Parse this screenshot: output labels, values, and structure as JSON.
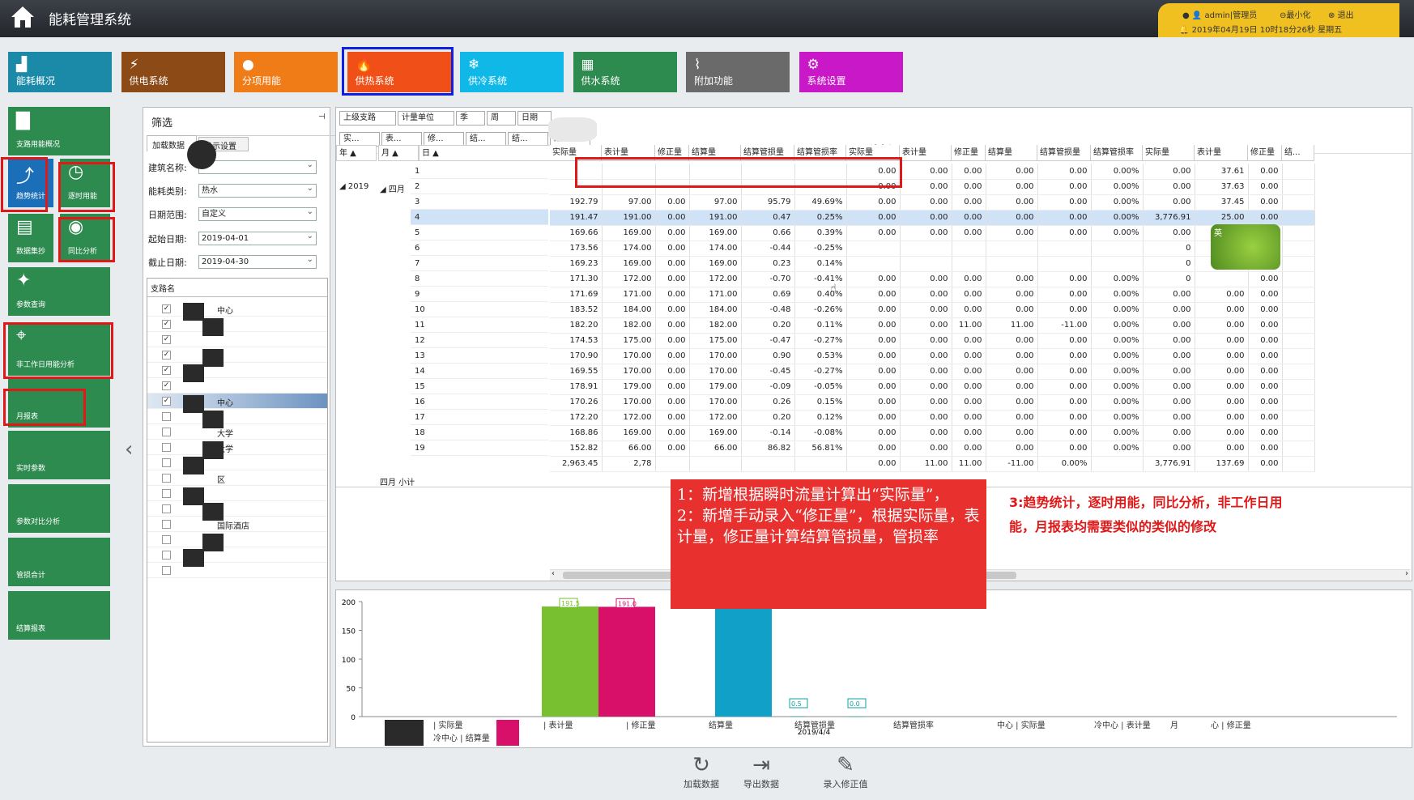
{
  "app": {
    "title": "能耗管理系统"
  },
  "user": {
    "account": "admin|管理员",
    "minimize": "最小化",
    "logout": "退出",
    "datetime": "2019年04月19日 10时18分26秒 星期五"
  },
  "nav": [
    {
      "label": "能耗概况",
      "icon": "stats-icon",
      "color": "#1a8aa8"
    },
    {
      "label": "供电系统",
      "icon": "power-icon",
      "color": "#8b4a16"
    },
    {
      "label": "分项用能",
      "icon": "user-icon",
      "color": "#f07c18"
    },
    {
      "label": "供热系统",
      "icon": "flame-icon",
      "color": "#f05018"
    },
    {
      "label": "供冷系统",
      "icon": "snowflake-icon",
      "color": "#10b8e8"
    },
    {
      "label": "供水系统",
      "icon": "grid-icon",
      "color": "#2e8b50"
    },
    {
      "label": "附加功能",
      "icon": "pulse-icon",
      "color": "#6a6a6a"
    },
    {
      "label": "系统设置",
      "icon": "gear-icon",
      "color": "#c818c8"
    }
  ],
  "side": [
    "支路用能概况",
    "趋势统计",
    "逐时用能",
    "数据集抄",
    "同比分析",
    "参数查询",
    "非工作日用能分析",
    "月报表",
    "实时参数",
    "参数对比分析",
    "管损合计",
    "结算报表"
  ],
  "filter": {
    "title": "筛选",
    "tab_load": "加载数据",
    "tab_adv": "显示设置",
    "building_label": "建筑名称:",
    "type_label": "能耗类别:",
    "type_value": "热水",
    "range_label": "日期范围:",
    "range_value": "自定义",
    "start_label": "起始日期:",
    "start_value": "2019-04-01",
    "end_label": "截止日期:",
    "end_value": "2019-04-30",
    "list_header": "支路名",
    "items": [
      "中心",
      "",
      "",
      "",
      "",
      "",
      "中心",
      "",
      "大学",
      "大学",
      "",
      "区",
      "",
      "",
      "国际酒店",
      "",
      "",
      ""
    ]
  },
  "grid": {
    "dims1": [
      "上级支路",
      "计量单位",
      "季",
      "周",
      "日期"
    ],
    "dims2": [
      "实...",
      "表...",
      "修...",
      "结...",
      "结...",
      "结..."
    ],
    "rowhdr": [
      "年",
      "月",
      "日"
    ],
    "year": "2019",
    "month": "四月",
    "subtotal_label": "四月 小计",
    "group2": "冷中心",
    "cols": [
      "实际量",
      "表计量",
      "修正量",
      "结算量",
      "结算管损量",
      "结算管损率",
      "实际量",
      "表计量",
      "修正量",
      "结算量",
      "结算管损量",
      "结算管损率",
      "实际量",
      "表计量",
      "修正量",
      "结..."
    ],
    "days": [
      "1",
      "2",
      "3",
      "4",
      "5",
      "6",
      "7",
      "8",
      "9",
      "10",
      "11",
      "12",
      "13",
      "14",
      "15",
      "16",
      "17",
      "18",
      "19"
    ],
    "rows": [
      [
        "",
        "",
        "",
        "",
        "",
        "",
        "0.00",
        "0.00",
        "0.00",
        "0.00",
        "0.00",
        "0.00%",
        "0.00",
        "37.61",
        "0.00"
      ],
      [
        "",
        "",
        "",
        "",
        "",
        "",
        "0.00",
        "0.00",
        "0.00",
        "0.00",
        "0.00",
        "0.00%",
        "0.00",
        "37.63",
        "0.00"
      ],
      [
        "192.79",
        "97.00",
        "0.00",
        "97.00",
        "95.79",
        "49.69%",
        "0.00",
        "0.00",
        "0.00",
        "0.00",
        "0.00",
        "0.00%",
        "0.00",
        "37.45",
        "0.00"
      ],
      [
        "191.47",
        "191.00",
        "0.00",
        "191.00",
        "0.47",
        "0.25%",
        "0.00",
        "0.00",
        "0.00",
        "0.00",
        "0.00",
        "0.00%",
        "3,776.91",
        "25.00",
        "0.00"
      ],
      [
        "169.66",
        "169.00",
        "0.00",
        "169.00",
        "0.66",
        "0.39%",
        "0.00",
        "0.00",
        "0.00",
        "0.00",
        "0.00",
        "0.00%",
        "0.00",
        "0.00",
        "0.00"
      ],
      [
        "173.56",
        "174.00",
        "0.00",
        "174.00",
        "-0.44",
        "-0.25%",
        "",
        "",
        "",
        "",
        "",
        "",
        "0",
        "",
        "0.00"
      ],
      [
        "169.23",
        "169.00",
        "0.00",
        "169.00",
        "0.23",
        "0.14%",
        "",
        "",
        "",
        "",
        "",
        "",
        "0",
        "",
        "0.00"
      ],
      [
        "171.30",
        "172.00",
        "0.00",
        "172.00",
        "-0.70",
        "-0.41%",
        "0.00",
        "0.00",
        "0.00",
        "0.00",
        "0.00",
        "0.00%",
        "0",
        "",
        "0.00"
      ],
      [
        "171.69",
        "171.00",
        "0.00",
        "171.00",
        "0.69",
        "0.40%",
        "0.00",
        "0.00",
        "0.00",
        "0.00",
        "0.00",
        "0.00%",
        "0.00",
        "0.00",
        "0.00"
      ],
      [
        "183.52",
        "184.00",
        "0.00",
        "184.00",
        "-0.48",
        "-0.26%",
        "0.00",
        "0.00",
        "0.00",
        "0.00",
        "0.00",
        "0.00%",
        "0.00",
        "0.00",
        "0.00"
      ],
      [
        "182.20",
        "182.00",
        "0.00",
        "182.00",
        "0.20",
        "0.11%",
        "0.00",
        "0.00",
        "11.00",
        "11.00",
        "-11.00",
        "0.00%",
        "0.00",
        "0.00",
        "0.00"
      ],
      [
        "174.53",
        "175.00",
        "0.00",
        "175.00",
        "-0.47",
        "-0.27%",
        "0.00",
        "0.00",
        "0.00",
        "0.00",
        "0.00",
        "0.00%",
        "0.00",
        "0.00",
        "0.00"
      ],
      [
        "170.90",
        "170.00",
        "0.00",
        "170.00",
        "0.90",
        "0.53%",
        "0.00",
        "0.00",
        "0.00",
        "0.00",
        "0.00",
        "0.00%",
        "0.00",
        "0.00",
        "0.00"
      ],
      [
        "169.55",
        "170.00",
        "0.00",
        "170.00",
        "-0.45",
        "-0.27%",
        "0.00",
        "0.00",
        "0.00",
        "0.00",
        "0.00",
        "0.00%",
        "0.00",
        "0.00",
        "0.00"
      ],
      [
        "178.91",
        "179.00",
        "0.00",
        "179.00",
        "-0.09",
        "-0.05%",
        "0.00",
        "0.00",
        "0.00",
        "0.00",
        "0.00",
        "0.00%",
        "0.00",
        "0.00",
        "0.00"
      ],
      [
        "170.26",
        "170.00",
        "0.00",
        "170.00",
        "0.26",
        "0.15%",
        "0.00",
        "0.00",
        "0.00",
        "0.00",
        "0.00",
        "0.00%",
        "0.00",
        "0.00",
        "0.00"
      ],
      [
        "172.20",
        "172.00",
        "0.00",
        "172.00",
        "0.20",
        "0.12%",
        "0.00",
        "0.00",
        "0.00",
        "0.00",
        "0.00",
        "0.00%",
        "0.00",
        "0.00",
        "0.00"
      ],
      [
        "168.86",
        "169.00",
        "0.00",
        "169.00",
        "-0.14",
        "-0.08%",
        "0.00",
        "0.00",
        "0.00",
        "0.00",
        "0.00",
        "0.00%",
        "0.00",
        "0.00",
        "0.00"
      ],
      [
        "152.82",
        "66.00",
        "0.00",
        "66.00",
        "86.82",
        "56.81%",
        "0.00",
        "0.00",
        "0.00",
        "0.00",
        "0.00",
        "0.00%",
        "0.00",
        "0.00",
        "0.00"
      ]
    ],
    "subtotal": [
      "2,963.45",
      "2,78",
      "",
      "",
      "",
      "",
      "0.00",
      "11.00",
      "11.00",
      "-11.00",
      "0.00%",
      "",
      "3,776.91",
      "137.69",
      "0.00"
    ]
  },
  "chart_data": {
    "type": "bar",
    "categories": [
      "2019/4/4"
    ],
    "yticks": [
      "200",
      "150",
      "100",
      "50",
      "0"
    ],
    "ylim": [
      0,
      200
    ],
    "series": [
      {
        "name": "实际量",
        "value": 191.5,
        "label": "191.5",
        "color": "#78c030"
      },
      {
        "name": "表计量",
        "value": 191.0,
        "label": "191.0",
        "color": "#d8106a"
      },
      {
        "name": "结算量",
        "value": 191.0,
        "label": "",
        "color": "#10a0c8"
      },
      {
        "name": "结算管损量",
        "value": 0.5,
        "label": "0.5",
        "color": "#10a0a0"
      },
      {
        "name": "结算管损率",
        "value": 0.0,
        "label": "0.0",
        "color": "#10a0a0"
      }
    ],
    "legend": [
      "| 实际量",
      "冷中心 | 结算量",
      "| 表计量",
      "| 修正量",
      "结算量",
      "结算管损量",
      "结算管损率",
      "中心 | 实际量",
      "冷中心 | 表计量",
      "月",
      "心 | 修正量"
    ]
  },
  "callout": {
    "line1": "1：新增根据瞬时流量计算出“实际量”，",
    "line2": "2：新增手动录入“修正量”，根据实际量，表计量，修正量计算结算管损量，管损率"
  },
  "note": "3:趋势统计，逐时用能，同比分析，非工作日用能，月报表均需要类似的类似的修改",
  "bottom": [
    "加载数据",
    "导出数据",
    "录入修正值"
  ]
}
